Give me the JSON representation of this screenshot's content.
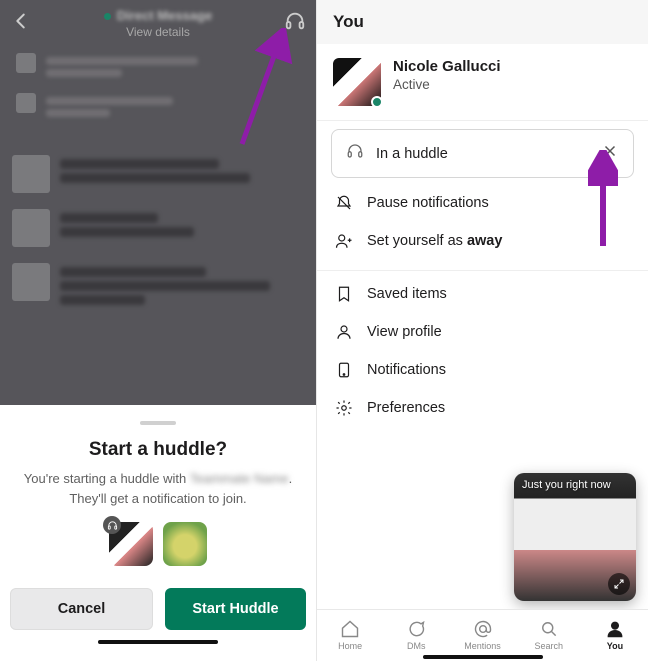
{
  "left": {
    "header": {
      "title_blurred": "Direct Message",
      "subtitle": "View details"
    },
    "sheet": {
      "title": "Start a huddle?",
      "subtext_pre": "You're starting a huddle with ",
      "subtext_name_blurred": "Teammate Name",
      "subtext_post": ". They'll get a notification to join.",
      "cancel": "Cancel",
      "start": "Start Huddle"
    }
  },
  "right": {
    "header": "You",
    "profile": {
      "name": "Nicole Gallucci",
      "status": "Active"
    },
    "status_chip": {
      "label": "In a huddle"
    },
    "menu1": {
      "pause": "Pause notifications",
      "away_pre": "Set yourself as ",
      "away_bold": "away"
    },
    "menu2": {
      "saved": "Saved items",
      "profile": "View profile",
      "notifications": "Notifications",
      "preferences": "Preferences"
    },
    "pip": {
      "label": "Just you right now"
    },
    "tabs": {
      "home": "Home",
      "dms": "DMs",
      "mentions": "Mentions",
      "search": "Search",
      "you": "You"
    }
  },
  "colors": {
    "accent": "#037a5a",
    "arrow": "#8e1da8"
  }
}
